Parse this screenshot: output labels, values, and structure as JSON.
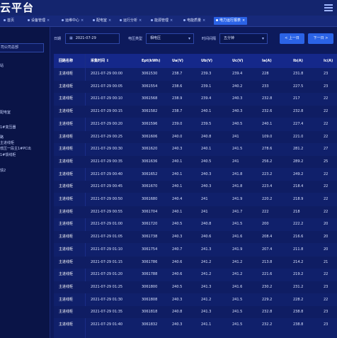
{
  "app": {
    "title": "云平台"
  },
  "nav": {
    "tabs": [
      {
        "label": "首页"
      },
      {
        "label": "设备管理"
      },
      {
        "label": "运维中心"
      },
      {
        "label": "配电室"
      },
      {
        "label": "运行分析"
      },
      {
        "label": "能源管理"
      },
      {
        "label": "电能质量"
      },
      {
        "label": "电力运行报表"
      }
    ]
  },
  "sidebar": {
    "search_value": "司公司总部",
    "items": [
      {
        "label": "站"
      },
      {
        "label": "配电室"
      },
      {
        "label": "1#变压器"
      },
      {
        "label": "路"
      },
      {
        "label": "主进线柜"
      },
      {
        "label": "低压一段主1#PC出"
      },
      {
        "label": "1#馈线柜"
      },
      {
        "label": "馈2"
      }
    ]
  },
  "filters": {
    "date_label": "日期",
    "date_value": "2021-07-29",
    "type_label": "电压类型",
    "type_value": "相电压",
    "interval_label": "时间间隔",
    "interval_value": "五分钟",
    "prev_label": "< 上一日",
    "next_label": "下一日 >"
  },
  "table": {
    "headers": [
      "回路名称",
      "采集时间 ↕",
      "Ept(kWh)",
      "Ua(V)",
      "Ub(V)",
      "Uc(V)",
      "Ia(A)",
      "Ib(A)",
      "Ic(A)"
    ],
    "rows": [
      [
        "主进线柜",
        "2021-07-29 00:00",
        "3061530",
        "238.7",
        "239.3",
        "239.4",
        "228",
        "231.8",
        "23"
      ],
      [
        "主进线柜",
        "2021-07-29 00:05",
        "3061554",
        "238.6",
        "239.1",
        "240.2",
        "233",
        "227.5",
        "23"
      ],
      [
        "主进线柜",
        "2021-07-29 00:10",
        "3061568",
        "238.9",
        "239.4",
        "240.3",
        "232.8",
        "217",
        "22"
      ],
      [
        "主进线柜",
        "2021-07-29 00:15",
        "3061582",
        "238.7",
        "240.1",
        "240.3",
        "232.6",
        "232.8",
        "22"
      ],
      [
        "主进线柜",
        "2021-07-29 00:20",
        "3061596",
        "239.0",
        "239.5",
        "240.5",
        "240.1",
        "227.4",
        "22"
      ],
      [
        "主进线柜",
        "2021-07-29 00:25",
        "3061606",
        "240.0",
        "240.8",
        "241",
        "109.0",
        "221.0",
        "22"
      ],
      [
        "主进线柜",
        "2021-07-29 00:30",
        "3061620",
        "240.3",
        "240.1",
        "241.5",
        "278.6",
        "281.2",
        "27"
      ],
      [
        "主进线柜",
        "2021-07-29 00:35",
        "3061636",
        "240.1",
        "240.5",
        "241",
        "256.2",
        "289.2",
        "25"
      ],
      [
        "主进线柜",
        "2021-07-29 00:40",
        "3061652",
        "240.1",
        "240.3",
        "241.8",
        "223.2",
        "249.2",
        "22"
      ],
      [
        "主进线柜",
        "2021-07-29 00:45",
        "3061670",
        "240.1",
        "240.3",
        "241.8",
        "223.4",
        "218.4",
        "22"
      ],
      [
        "主进线柜",
        "2021-07-29 00:50",
        "3061680",
        "240.4",
        "241",
        "241.9",
        "220.2",
        "218.9",
        "22"
      ],
      [
        "主进线柜",
        "2021-07-29 00:55",
        "3061704",
        "240.1",
        "241",
        "241.7",
        "222",
        "218",
        "22"
      ],
      [
        "主进线柜",
        "2021-07-29 01:00",
        "3061720",
        "240.5",
        "240.8",
        "241.5",
        "200",
        "222.2",
        "20"
      ],
      [
        "主进线柜",
        "2021-07-29 01:05",
        "3061738",
        "240.3",
        "240.6",
        "241.6",
        "208.4",
        "216.6",
        "20"
      ],
      [
        "主进线柜",
        "2021-07-29 01:10",
        "3061754",
        "240.7",
        "241.3",
        "241.9",
        "207.4",
        "211.8",
        "20"
      ],
      [
        "主进线柜",
        "2021-07-29 01:15",
        "3061786",
        "240.6",
        "241.2",
        "241.2",
        "213.8",
        "214.2",
        "21"
      ],
      [
        "主进线柜",
        "2021-07-29 01:20",
        "3061788",
        "240.6",
        "241.2",
        "241.2",
        "221.6",
        "219.2",
        "22"
      ],
      [
        "主进线柜",
        "2021-07-29 01:25",
        "3061800",
        "240.5",
        "241.3",
        "241.6",
        "230.2",
        "231.2",
        "23"
      ],
      [
        "主进线柜",
        "2021-07-29 01:30",
        "3061808",
        "240.3",
        "241.2",
        "241.5",
        "229.2",
        "228.2",
        "22"
      ],
      [
        "主进线柜",
        "2021-07-29 01:35",
        "3061818",
        "240.8",
        "241.3",
        "241.5",
        "232.8",
        "238.8",
        "23"
      ],
      [
        "主进线柜",
        "2021-07-29 01:40",
        "3061832",
        "240.3",
        "241.1",
        "241.5",
        "232.2",
        "238.8",
        "23"
      ]
    ]
  },
  "colors": {
    "background": "#0d1a5c",
    "header": "#14256e",
    "accent": "#2b63e6",
    "table_bg": "#10206b"
  }
}
